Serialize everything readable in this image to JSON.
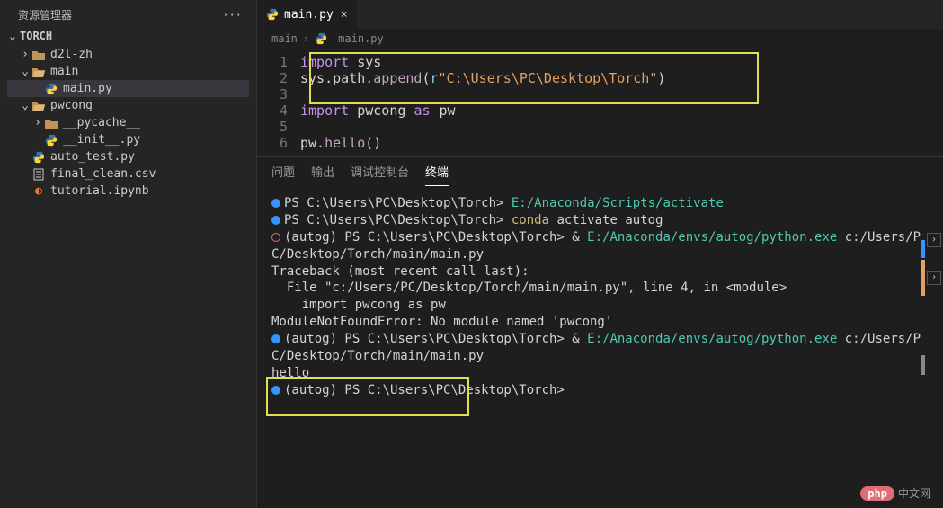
{
  "sidebar": {
    "title": "资源管理器",
    "root": "TORCH",
    "items": [
      {
        "label": "d2l-zh"
      },
      {
        "label": "main"
      },
      {
        "label": "main.py"
      },
      {
        "label": "pwcong"
      },
      {
        "label": "__pycache__"
      },
      {
        "label": "__init__.py"
      },
      {
        "label": "auto_test.py"
      },
      {
        "label": "final_clean.csv"
      },
      {
        "label": "tutorial.ipynb"
      }
    ]
  },
  "tab": {
    "filename": "main.py",
    "close": "×"
  },
  "breadcrumb": {
    "seg1": "main",
    "sep": "›",
    "seg2": "main.py"
  },
  "code": {
    "l1": {
      "num": "1",
      "kw": "import",
      "rest": " sys"
    },
    "l2": {
      "num": "2",
      "pre": "sys.path.",
      "fn": "append",
      "open": "(",
      "r": "r",
      "str": "\"C:\\Users\\PC\\Desktop\\Torch\"",
      "close": ")"
    },
    "l3": {
      "num": "3"
    },
    "l4": {
      "num": "4",
      "kw": "import",
      "mid": " pwcong ",
      "as": "as",
      "rest": " pw"
    },
    "l5": {
      "num": "5"
    },
    "l6": {
      "num": "6",
      "pre": "pw.",
      "fn": "hello",
      "paren": "()"
    }
  },
  "panel": {
    "t1": "问题",
    "t2": "输出",
    "t3": "调试控制台",
    "t4": "终端"
  },
  "term": {
    "l1a": "PS C:\\Users\\PC\\Desktop\\Torch> ",
    "l1b": "E:/Anaconda/Scripts/activate",
    "l2a": "PS C:\\Users\\PC\\Desktop\\Torch> ",
    "l2b": "conda",
    "l2c": " activate autog",
    "l3a": "(autog) PS C:\\Users\\PC\\Desktop\\Torch> & ",
    "l3b": "E:/Anaconda/envs/autog/python.exe",
    "l3c": " c:/Users/PC/Desktop/Torch/main/main.py",
    "l4": "Traceback (most recent call last):",
    "l5": "  File \"c:/Users/PC/Desktop/Torch/main/main.py\", line 4, in <module>",
    "l6": "    import pwcong as pw",
    "l7": "ModuleNotFoundError: No module named 'pwcong'",
    "l8a": "(autog) PS C:\\Users\\PC\\Desktop\\Torch> & ",
    "l8b": "E:/Anaconda/envs/autog/python.exe",
    "l8c": " c:/Users/PC/Desktop/Torch/main/main.py",
    "l9": "hello",
    "l10": "(autog) PS C:\\Users\\PC\\Desktop\\Torch>"
  },
  "watermark": {
    "badge": "php",
    "text": "中文网"
  }
}
